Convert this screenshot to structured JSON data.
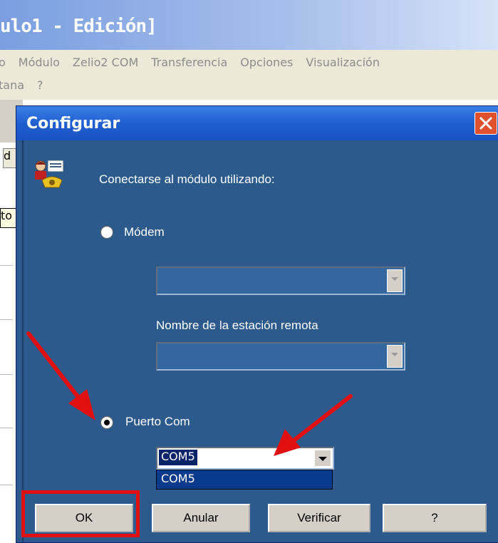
{
  "window": {
    "title_fragment": "ulo1 - Edición]",
    "menu_row1": [
      "o",
      "Módulo",
      "Zelio2 COM",
      "Transferencia",
      "Opciones",
      "Visualización"
    ],
    "menu_row2": [
      "tana",
      "?"
    ],
    "left_edit_fragment": "d",
    "left_tip_fragment": "to"
  },
  "dialog": {
    "title": "Configurar",
    "prompt": "Conectarse al módulo utilizando:",
    "modem_label": "Módem",
    "remote_station_label": "Nombre de la estación remota",
    "com_label": "Puerto Com",
    "com_value": "COM5",
    "com_options": [
      "COM5"
    ],
    "modem_selected": false,
    "com_selected": true
  },
  "buttons": {
    "ok": "OK",
    "cancel": "Anular",
    "verify": "Verificar",
    "help": "?"
  },
  "colors": {
    "dialog_bg": "#2c5a8c",
    "titlebar": "#1f5fd0",
    "highlight_box": "#e01010",
    "arrow": "#e01010"
  }
}
